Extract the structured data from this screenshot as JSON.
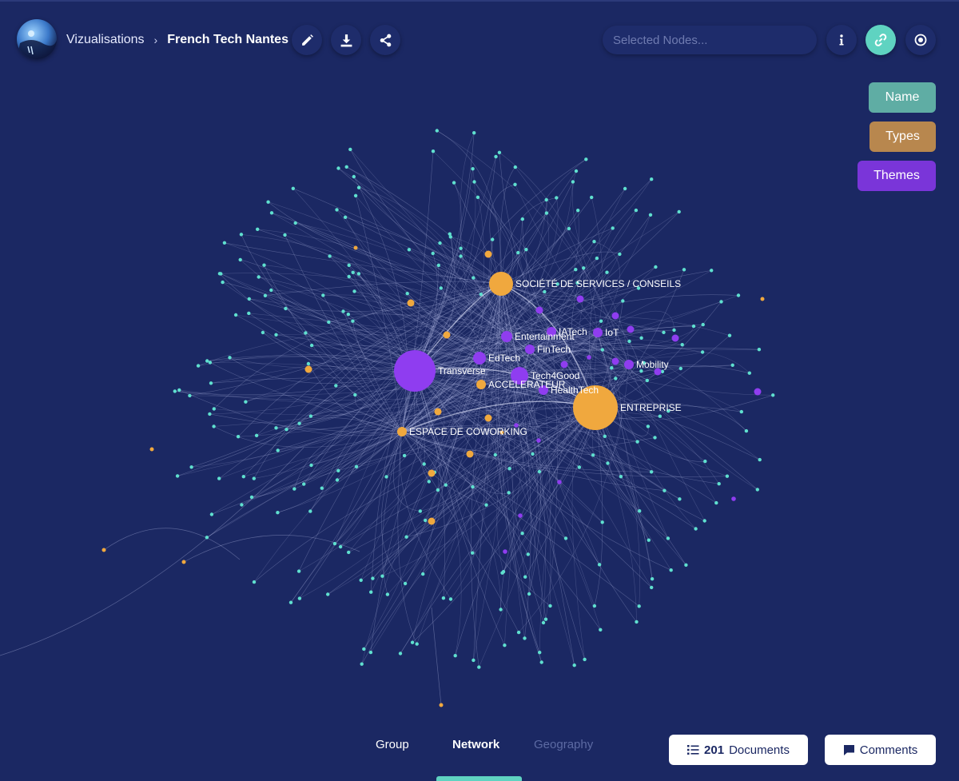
{
  "header": {
    "breadcrumb_root": "Vizualisations",
    "breadcrumb_current": "French Tech Nantes",
    "search_placeholder": "Selected Nodes..."
  },
  "filters": [
    {
      "label": "Name",
      "color": "#5fada4"
    },
    {
      "label": "Types",
      "color": "#b8874e"
    },
    {
      "label": "Themes",
      "color": "#7a35d9"
    }
  ],
  "graph": {
    "colors": {
      "entity": "#5fe0cf",
      "type": "#f0a83e",
      "theme": "#8f3df0",
      "edge": "#c8cdf5"
    },
    "types": [
      {
        "label": "SOCIÉTÉ DE SERVICES / CONSEILS"
      },
      {
        "label": "ENTREPRISE"
      },
      {
        "label": "ACCELERATEUR"
      },
      {
        "label": "ESPACE DE COWORKING"
      }
    ],
    "themes": [
      {
        "label": "Transverse"
      },
      {
        "label": "Entertainment"
      },
      {
        "label": "IATech"
      },
      {
        "label": "IoT"
      },
      {
        "label": "EdTech"
      },
      {
        "label": "FinTech"
      },
      {
        "label": "Tech4Good"
      },
      {
        "label": "Mobility"
      },
      {
        "label": "HealthTech"
      }
    ]
  },
  "tabs": [
    {
      "label": "Group",
      "active": false
    },
    {
      "label": "Network",
      "active": true
    },
    {
      "label": "Geography",
      "active": false,
      "disabled": true
    }
  ],
  "documents": {
    "count": "201",
    "label": "Documents"
  },
  "comments_label": "Comments",
  "icons": [
    "logo-globe",
    "chevron-right-icon",
    "pencil-icon",
    "download-icon",
    "share-icon",
    "info-icon",
    "link-icon",
    "record-icon",
    "list-icon",
    "comment-icon"
  ]
}
